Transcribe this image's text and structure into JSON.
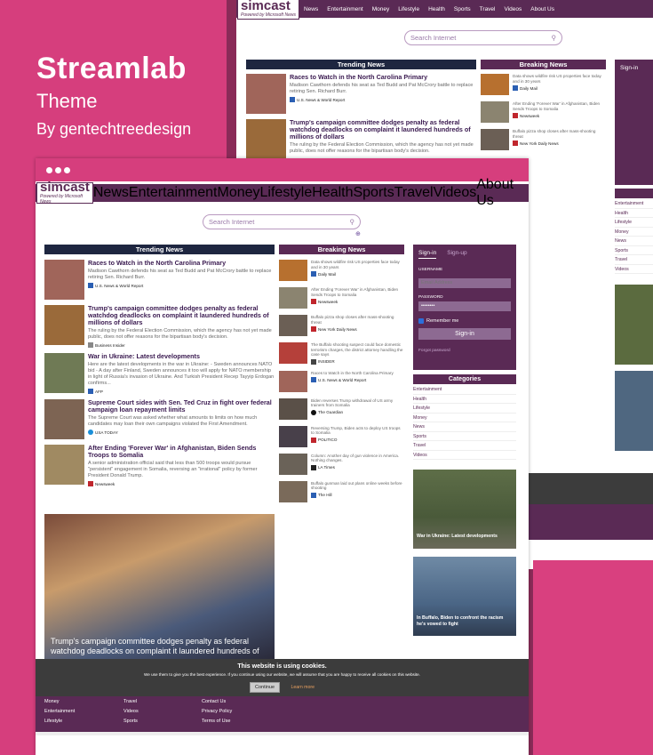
{
  "promo": {
    "title": "Streamlab",
    "subtitle": "Theme",
    "byline": "By gentechtreedesign"
  },
  "logo": {
    "word": "simcast",
    "powered": "Powered by Microsoft News"
  },
  "nav": [
    "News",
    "Entertainment",
    "Money",
    "Lifestyle",
    "Health",
    "Sports",
    "Travel",
    "Videos",
    "About Us"
  ],
  "search": {
    "placeholder": "Search Internet"
  },
  "trending": {
    "header": "Trending News",
    "items": [
      {
        "title": "Races to Watch in the North Carolina Primary",
        "desc": "Madison Cawthorn defends his seat as Ted Budd and Pat McCrory battle to replace retiring Sen. Richard Burr.",
        "source": "U.S. News & World Report"
      },
      {
        "title": "Trump's campaign committee dodges penalty as federal watchdog deadlocks on complaint it laundered hundreds of millions of dollars",
        "desc": "The ruling by the Federal Election Commission, which the agency has not yet made public, does not offer reasons for the bipartisan body's decision.",
        "source": "Business Insider"
      },
      {
        "title": "War in Ukraine: Latest developments",
        "desc": "Here are the latest developments in the war in Ukraine: - Sweden announces NATO bid - A day after Finland, Sweden announces it too will apply for NATO membership in light of Russia's invasion of Ukraine. And Turkish President Recep Tayyip Erdogan confirms...",
        "source": "AFP"
      },
      {
        "title": "Supreme Court sides with Sen. Ted Cruz in fight over federal campaign loan repayment limits",
        "desc": "The Supreme Court was asked whether what amounts to limits on how much candidates may loan their own campaigns violated the First Amendment.",
        "source": "USA TODAY"
      },
      {
        "title": "After Ending 'Forever War' in Afghanistan, Biden Sends Troops to Somalia",
        "desc": "A senior administration official said that less than 500 troops would pursue \"persistent\" engagement in Somalia, reversing an \"irrational\" policy by former President Donald Trump.",
        "source": "Newsweek"
      }
    ],
    "hero_caption": "Trump's campaign committee dodges penalty as federal watchdog deadlocks on complaint it laundered hundreds of"
  },
  "breaking": {
    "header": "Breaking News",
    "items": [
      {
        "title": "Data shows wildfire risk US properties face today and in 30 years",
        "source": "Daily Mail"
      },
      {
        "title": "After Ending 'Forever War' in Afghanistan, Biden Sends Troops to Somalia",
        "source": "Newsweek"
      },
      {
        "title": "Buffalo pizza shop closes after mass-shooting threat",
        "source": "New York Daily News"
      },
      {
        "title": "The Buffalo shooting suspect could face domestic terrorism charges, the district attorney handling the case says",
        "source": "INSIDER"
      },
      {
        "title": "Races to Watch in the North Carolina Primary",
        "source": "U.S. News & World Report"
      },
      {
        "title": "Biden reverses Trump withdrawal of US army trainers from Somalia",
        "source": "The Guardian"
      },
      {
        "title": "Reversing Trump, Biden acts to deploy US troops to Somalia",
        "source": "POLITICO"
      },
      {
        "title": "Column: Another day of gun violence in America. Nothing changes.",
        "source": "LA Times"
      },
      {
        "title": "Buffalo gunman laid out plans online weeks before shooting",
        "source": "The Hill"
      }
    ]
  },
  "signin": {
    "tab_signin": "Sign-in",
    "tab_signup": "Sign-up",
    "username_label": "USERNAME",
    "username_placeholder": "Email Address",
    "password_label": "PASSWORD",
    "password_value": "••••••••",
    "remember": "Remember me",
    "button": "Sign-in",
    "forgot": "Forgot password"
  },
  "categories": {
    "header": "Categories",
    "items": [
      "Entertainment",
      "Health",
      "Lifestyle",
      "Money",
      "News",
      "Sports",
      "Travel",
      "Videos"
    ]
  },
  "side_cards": [
    {
      "caption": "War in Ukraine: Latest developments"
    },
    {
      "caption": "In Buffalo, Biden to confront the racism he's vowed to fight"
    }
  ],
  "cookie": {
    "title": "This website is using cookies.",
    "desc": "We use them to give you the best experience. If you continue using our website, we will assume that you are happy to receive all cookies on this website.",
    "button": "Continue",
    "link": "Learn more"
  },
  "footer": {
    "col1": [
      "Money",
      "Entertainment",
      "Lifestyle"
    ],
    "col2": [
      "Travel",
      "Videos",
      "Sports"
    ],
    "col3": [
      "Contact Us",
      "Privacy Policy",
      "Terms of Use"
    ]
  }
}
